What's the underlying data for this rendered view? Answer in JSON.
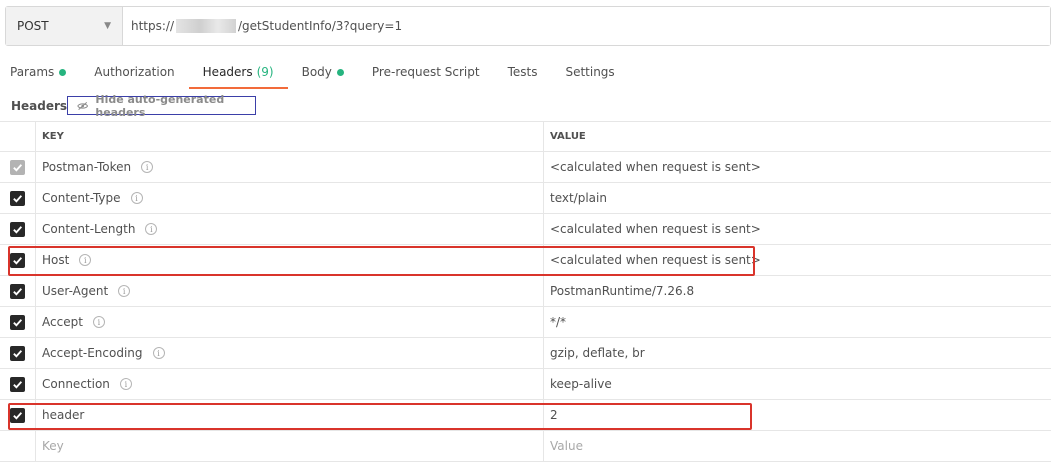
{
  "request": {
    "method": "POST",
    "url_prefix": "https://",
    "url_suffix": "/getStudentInfo/3?query=1"
  },
  "tabs": [
    {
      "label": "Params",
      "dot": true
    },
    {
      "label": "Authorization",
      "dot": false
    },
    {
      "label": "Headers",
      "count": "(9)",
      "active": true
    },
    {
      "label": "Body",
      "dot": true
    },
    {
      "label": "Pre-request Script",
      "dot": false
    },
    {
      "label": "Tests",
      "dot": false
    },
    {
      "label": "Settings",
      "dot": false
    }
  ],
  "headers_section": {
    "label": "Headers",
    "hide_button": "Hide auto-generated headers"
  },
  "table": {
    "col_key": "KEY",
    "col_value": "VALUE",
    "rows": [
      {
        "key": "Postman-Token",
        "value": "<calculated when request is sent>",
        "checked": true,
        "disabled": true,
        "info": true
      },
      {
        "key": "Content-Type",
        "value": "text/plain",
        "checked": true,
        "info": true
      },
      {
        "key": "Content-Length",
        "value": "<calculated when request is sent>",
        "checked": true,
        "info": true
      },
      {
        "key": "Host",
        "value": "<calculated when request is sent>",
        "checked": true,
        "info": true
      },
      {
        "key": "User-Agent",
        "value": "PostmanRuntime/7.26.8",
        "checked": true,
        "info": true
      },
      {
        "key": "Accept",
        "value": "*/*",
        "checked": true,
        "info": true
      },
      {
        "key": "Accept-Encoding",
        "value": "gzip, deflate, br",
        "checked": true,
        "info": true
      },
      {
        "key": "Connection",
        "value": "keep-alive",
        "checked": true,
        "info": true
      },
      {
        "key": "header",
        "value": "2",
        "checked": true,
        "info": false
      }
    ],
    "new_row": {
      "key_placeholder": "Key",
      "value_placeholder": "Value"
    }
  },
  "colors": {
    "accent": "#f26b3a",
    "green": "#26b47f",
    "highlight_red": "#d9342b",
    "highlight_blue": "#3b3fa8"
  }
}
